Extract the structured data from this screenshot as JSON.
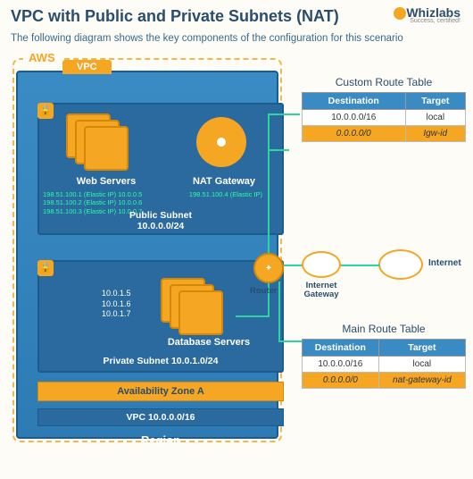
{
  "title": "VPC with Public and Private Subnets (NAT)",
  "subtitle": "The following diagram shows the key components of the configuration for this scenario",
  "brand": {
    "name": "Whizlabs",
    "tagline": "Success, certified!"
  },
  "aws_label": "AWS",
  "vpc_tab": "VPC",
  "public_subnet": {
    "web_servers_label": "Web Servers",
    "nat_label": "NAT Gateway",
    "ip_lines": [
      "198.51.100.1 (Elastic IP) 10.0.0.5",
      "198.51.100.2 (Elastic IP) 10.0.0.6",
      "198.51.100.3 (Elastic IP) 10.0.0.7"
    ],
    "nat_ip": "198.51.100.4 (Elastic IP)",
    "name": "Public Subnet",
    "cidr": "10.0.0.0/24"
  },
  "private_subnet": {
    "ips": [
      "10.0.1.5",
      "10.0.1.6",
      "10.0.1.7"
    ],
    "db_label": "Database Servers",
    "full_label": "Private Subnet 10.0.1.0/24"
  },
  "az_label": "Availability Zone A",
  "vpc_cidr_label": "VPC 10.0.0.0/16",
  "region_label": "Region",
  "router_label": "Router",
  "igw_label": "Internet Gateway",
  "internet_label": "Internet",
  "custom_route_table": {
    "title": "Custom Route Table",
    "headers": [
      "Destination",
      "Target"
    ],
    "rows": [
      {
        "dest": "10.0.0.0/16",
        "target": "local",
        "alt": false
      },
      {
        "dest": "0.0.0.0/0",
        "target": "Igw-id",
        "alt": true
      }
    ]
  },
  "main_route_table": {
    "title": "Main Route Table",
    "headers": [
      "Destination",
      "Target"
    ],
    "rows": [
      {
        "dest": "10.0.0.0/16",
        "target": "local",
        "alt": false
      },
      {
        "dest": "0.0.0.0/0",
        "target": "nat-gateway-id",
        "alt": true
      }
    ]
  }
}
